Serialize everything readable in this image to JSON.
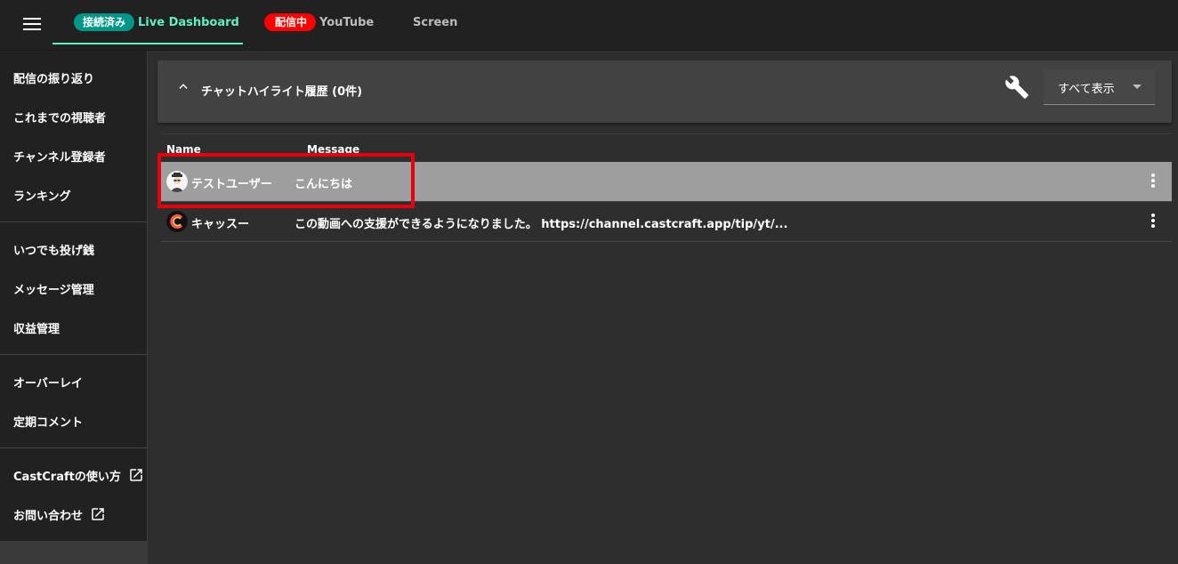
{
  "topbar": {
    "tabs": [
      {
        "chip": "接続済み",
        "label": "Live Dashboard",
        "active": true
      },
      {
        "chip": "配信中",
        "label": "YouTube",
        "active": false
      },
      {
        "chip": "",
        "label": "Screen",
        "active": false
      }
    ]
  },
  "sidebar": {
    "groups": [
      [
        "配信の振り返り",
        "これまでの視聴者",
        "チャンネル登録者",
        "ランキング"
      ],
      [
        "いつでも投げ銭",
        "メッセージ管理",
        "収益管理"
      ],
      [
        "オーバーレイ",
        "定期コメント"
      ],
      [
        "CastCraftの使い方",
        "お問い合わせ"
      ]
    ]
  },
  "panel": {
    "title": "チャットハイライト履歴 (0件)",
    "filter_value": "すべて表示"
  },
  "table": {
    "columns": [
      "Name",
      "Message"
    ],
    "rows": [
      {
        "name": "テストユーザー",
        "message": "こんにちは",
        "selected": true,
        "avatar": "test-user-avatar"
      },
      {
        "name": "キャッスー",
        "message": "この動画への支援ができるようになりました。 https://channel.castcraft.app/tip/yt/...",
        "selected": false,
        "avatar": "castcraft-logo-avatar"
      }
    ]
  },
  "colors": {
    "accent": "#5ff0c4",
    "connected_chip": "#009688",
    "live_chip": "#ff0000",
    "highlight_box": "#e8000d",
    "selected_row": "#9e9e9e"
  }
}
